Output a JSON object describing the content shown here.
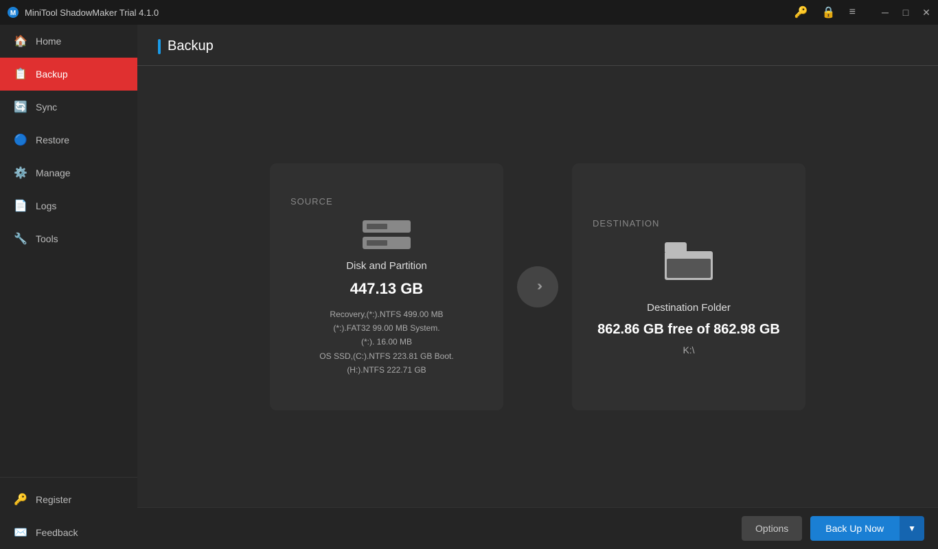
{
  "titleBar": {
    "appTitle": "MiniTool ShadowMaker Trial 4.1.0"
  },
  "sidebar": {
    "items": [
      {
        "id": "home",
        "label": "Home",
        "icon": "🏠",
        "active": false
      },
      {
        "id": "backup",
        "label": "Backup",
        "icon": "📋",
        "active": true
      },
      {
        "id": "sync",
        "label": "Sync",
        "icon": "🔄",
        "active": false
      },
      {
        "id": "restore",
        "label": "Restore",
        "icon": "🔵",
        "active": false
      },
      {
        "id": "manage",
        "label": "Manage",
        "icon": "⚙️",
        "active": false
      },
      {
        "id": "logs",
        "label": "Logs",
        "icon": "📄",
        "active": false
      },
      {
        "id": "tools",
        "label": "Tools",
        "icon": "🔧",
        "active": false
      }
    ],
    "bottomItems": [
      {
        "id": "register",
        "label": "Register",
        "icon": "🔑"
      },
      {
        "id": "feedback",
        "label": "Feedback",
        "icon": "✉️"
      }
    ]
  },
  "page": {
    "title": "Backup"
  },
  "source": {
    "label": "SOURCE",
    "mainText": "Disk and Partition",
    "sizeText": "447.13 GB",
    "details": [
      "Recovery,(*:).NTFS 499.00 MB",
      "(*:).FAT32 99.00 MB System.",
      "(*:). 16.00 MB",
      "OS SSD,(C:).NTFS 223.81 GB Boot.",
      "(H:).NTFS 222.71 GB"
    ]
  },
  "destination": {
    "label": "DESTINATION",
    "mainText": "Destination Folder",
    "freeText": "862.86 GB free of 862.98 GB",
    "pathText": "K:\\"
  },
  "footer": {
    "optionsLabel": "Options",
    "backupNowLabel": "Back Up Now"
  }
}
